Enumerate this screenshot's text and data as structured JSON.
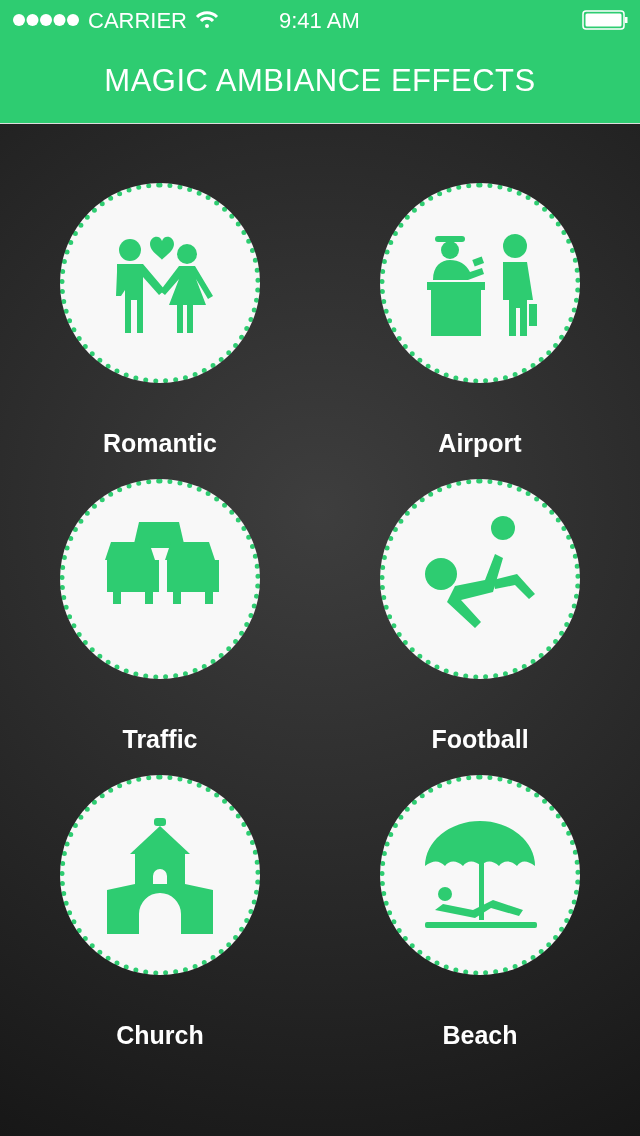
{
  "status_bar": {
    "carrier": "CARRIER",
    "time": "9:41 AM"
  },
  "header": {
    "title": "MAGIC AMBIANCE EFFECTS"
  },
  "effects": [
    {
      "kind": "romantic",
      "label": "Romantic"
    },
    {
      "kind": "airport",
      "label": "Airport"
    },
    {
      "kind": "traffic",
      "label": "Traffic"
    },
    {
      "kind": "football",
      "label": "Football"
    },
    {
      "kind": "church",
      "label": "Church"
    },
    {
      "kind": "beach",
      "label": "Beach"
    }
  ]
}
